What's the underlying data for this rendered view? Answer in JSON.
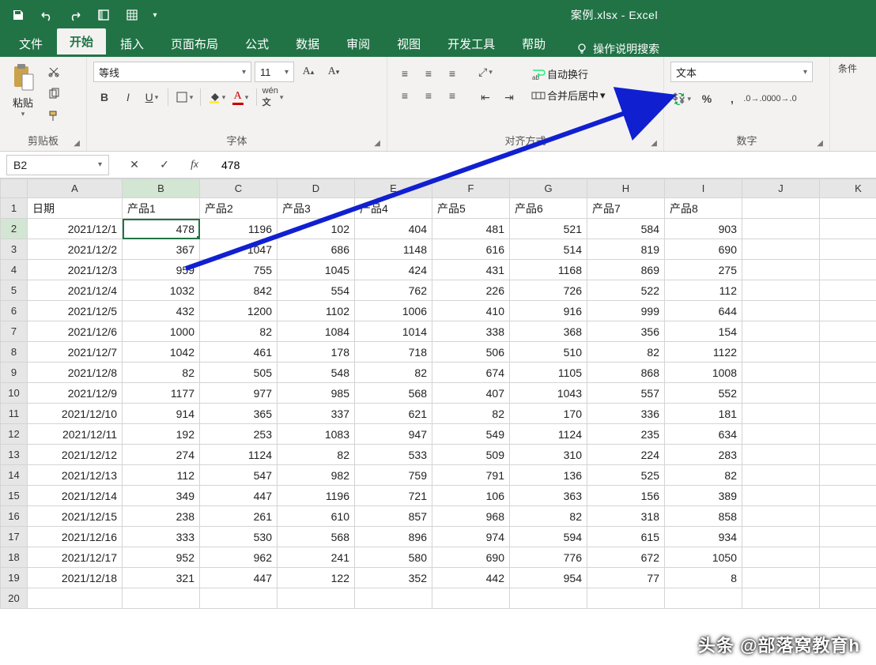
{
  "title": "案例.xlsx - Excel",
  "tabs": [
    "文件",
    "开始",
    "插入",
    "页面布局",
    "公式",
    "数据",
    "审阅",
    "视图",
    "开发工具",
    "帮助"
  ],
  "active_tab": "开始",
  "tell_me": "操作说明搜索",
  "ribbon": {
    "clipboard": {
      "paste": "粘贴",
      "label": "剪贴板"
    },
    "font": {
      "name": "等线",
      "size": "11",
      "label": "字体"
    },
    "align": {
      "wrap": "自动换行",
      "merge": "合并后居中",
      "label": "对齐方式"
    },
    "number": {
      "format": "文本",
      "label": "数字"
    },
    "cond": "条件"
  },
  "namebox": "B2",
  "formula": "478",
  "columns": [
    "A",
    "B",
    "C",
    "D",
    "E",
    "F",
    "G",
    "H",
    "I",
    "J",
    "K"
  ],
  "headers_row": [
    "日期",
    "产品1",
    "产品2",
    "产品3",
    "产品4",
    "产品5",
    "产品6",
    "产品7",
    "产品8"
  ],
  "rows": [
    [
      "2021/12/1",
      478,
      1196,
      102,
      404,
      481,
      521,
      584,
      903
    ],
    [
      "2021/12/2",
      367,
      1047,
      686,
      1148,
      616,
      514,
      819,
      690
    ],
    [
      "2021/12/3",
      959,
      755,
      1045,
      424,
      431,
      1168,
      869,
      275
    ],
    [
      "2021/12/4",
      1032,
      842,
      554,
      762,
      226,
      726,
      522,
      112
    ],
    [
      "2021/12/5",
      432,
      1200,
      1102,
      1006,
      410,
      916,
      999,
      644
    ],
    [
      "2021/12/6",
      1000,
      82,
      1084,
      1014,
      338,
      368,
      356,
      154
    ],
    [
      "2021/12/7",
      1042,
      461,
      178,
      718,
      506,
      510,
      82,
      1122
    ],
    [
      "2021/12/8",
      82,
      505,
      548,
      82,
      674,
      1105,
      868,
      1008
    ],
    [
      "2021/12/9",
      1177,
      977,
      985,
      568,
      407,
      1043,
      557,
      552
    ],
    [
      "2021/12/10",
      914,
      365,
      337,
      621,
      82,
      170,
      336,
      181
    ],
    [
      "2021/12/11",
      192,
      253,
      1083,
      947,
      549,
      1124,
      235,
      634
    ],
    [
      "2021/12/12",
      274,
      1124,
      82,
      533,
      509,
      310,
      224,
      283
    ],
    [
      "2021/12/13",
      112,
      547,
      982,
      759,
      791,
      136,
      525,
      82
    ],
    [
      "2021/12/14",
      349,
      447,
      1196,
      721,
      106,
      363,
      156,
      389
    ],
    [
      "2021/12/15",
      238,
      261,
      610,
      857,
      968,
      82,
      318,
      858
    ],
    [
      "2021/12/16",
      333,
      530,
      568,
      896,
      974,
      594,
      615,
      934
    ],
    [
      "2021/12/17",
      952,
      962,
      241,
      580,
      690,
      776,
      672,
      1050
    ],
    [
      "2021/12/18",
      321,
      447,
      122,
      352,
      442,
      954,
      "77",
      "8"
    ]
  ],
  "selected_cell": "B2",
  "watermark": "头条 @部落窝教育h"
}
